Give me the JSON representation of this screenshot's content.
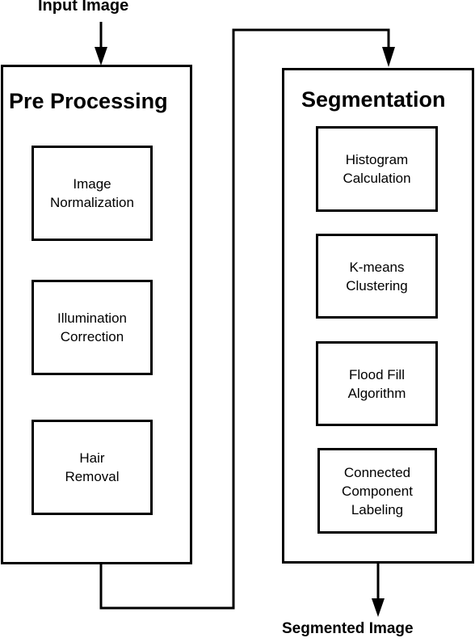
{
  "input_label": "Input Image",
  "output_label": "Segmented Image",
  "stages": [
    {
      "title": "Pre Processing",
      "steps": [
        "Image\nNormalization",
        "Illumination\nCorrection",
        "Hair\nRemoval"
      ]
    },
    {
      "title": "Segmentation",
      "steps": [
        "Histogram\nCalculation",
        "K-means\nClustering",
        "Flood Fill\nAlgorithm",
        "Connected\nComponent\nLabeling"
      ]
    }
  ],
  "colors": {
    "line": "#000000",
    "background": "#ffffff"
  }
}
